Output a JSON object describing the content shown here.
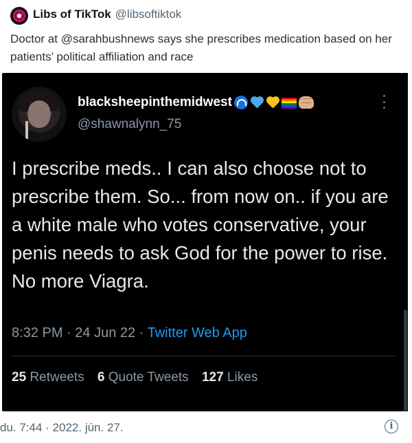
{
  "outer_tweet": {
    "display_name": "Libs of TikTok",
    "handle": "@libsoftiktok",
    "text": "Doctor at @sarahbushnews says she prescribes medication based on her patients’ political affiliation and race",
    "avatar_icon": "libs-of-tiktok-logo"
  },
  "quoted_tweet": {
    "display_name": "blacksheepinthemidwest",
    "name_emojis": [
      "wave-icon",
      "blue-heart-icon",
      "yellow-heart-icon",
      "rainbow-flag-icon",
      "fist-icon"
    ],
    "handle": "@shawnalynn_75",
    "text": "I prescribe meds.. I can also choose not to prescribe them. So... from now on.. if you are a white male who votes conservative, your penis needs to ask God for the power to rise. No more Viagra.",
    "time": "8:32 PM",
    "separator": "·",
    "date": "24 Jun 22",
    "source": "Twitter Web App",
    "stats": {
      "retweets_count": "25",
      "retweets_label": "Retweets",
      "quote_count": "6",
      "quote_label": "Quote Tweets",
      "likes_count": "127",
      "likes_label": "Likes"
    },
    "background": "#000000",
    "link_color": "#1d9bf0"
  },
  "footer": {
    "timestamp": "du. 7:44 · 2022. jún. 27.",
    "info_icon_glyph": "i"
  }
}
